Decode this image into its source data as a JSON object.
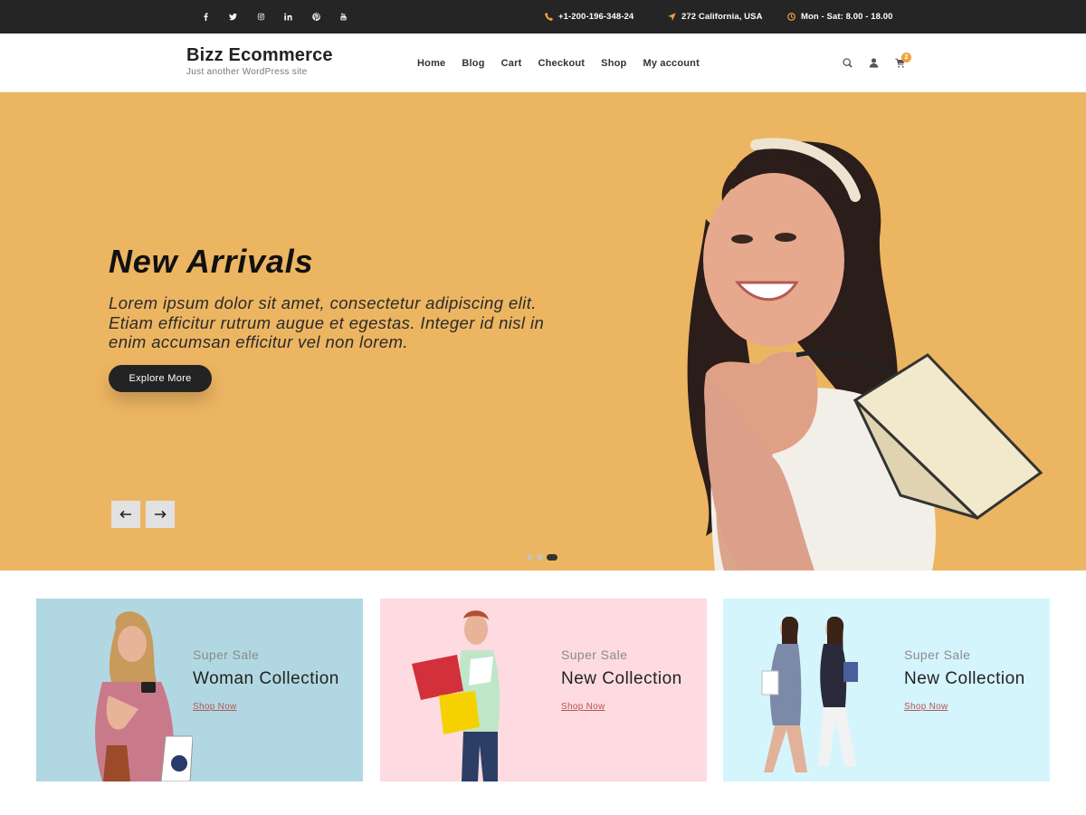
{
  "topbar": {
    "social": [
      "facebook-icon",
      "twitter-icon",
      "instagram-icon",
      "linkedin-icon",
      "pinterest-icon",
      "youtube-icon"
    ],
    "phone": "+1-200-196-348-24",
    "address": "272 California, USA",
    "hours": "Mon - Sat: 8.00 - 18.00"
  },
  "header": {
    "site_title": "Bizz Ecommerce",
    "tagline": "Just another WordPress site",
    "nav": [
      "Home",
      "Blog",
      "Cart",
      "Checkout",
      "Shop",
      "My account"
    ],
    "cart_count": "2"
  },
  "hero": {
    "title": "New Arrivals",
    "text": "Lorem ipsum dolor sit amet, consectetur adipiscing elit. Etiam efficitur rutrum augue et egestas. Integer id nisl in enim accumsan efficitur vel non lorem.",
    "button": "Explore More",
    "slides": 3,
    "active_slide": 3
  },
  "promos": [
    {
      "pre": "Super Sale",
      "title": "Woman Collection",
      "link": "Shop Now",
      "bg": "#b1d8e2"
    },
    {
      "pre": "Super Sale",
      "title": "New Collection",
      "link": "Shop Now",
      "bg": "#fedae1"
    },
    {
      "pre": "Super Sale",
      "title": "New Collection",
      "link": "Shop Now",
      "bg": "#d5f5fd"
    }
  ],
  "colors": {
    "topbar": "#252525",
    "accent": "#f0a23a",
    "hero_bg": "#ecb562",
    "button": "#232323"
  }
}
